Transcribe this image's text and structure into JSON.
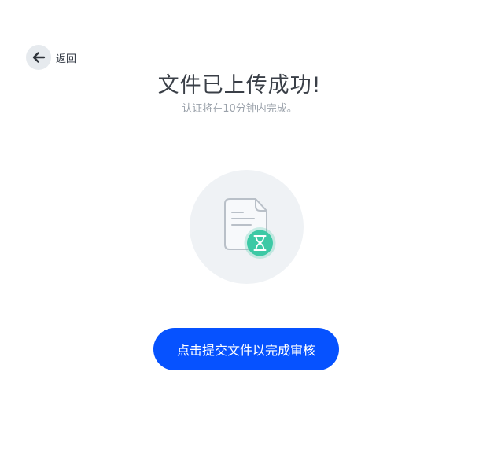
{
  "back": {
    "label": "返回"
  },
  "header": {
    "title": "文件已上传成功!",
    "subtitle": "认证将在10分钟内完成。"
  },
  "illustration": {
    "document_icon": "document-icon",
    "status_icon": "hourglass-icon",
    "accent_color": "#3cc9a5"
  },
  "actions": {
    "primary_label": "点击提交文件以完成审核",
    "primary_color": "#0652ff"
  }
}
